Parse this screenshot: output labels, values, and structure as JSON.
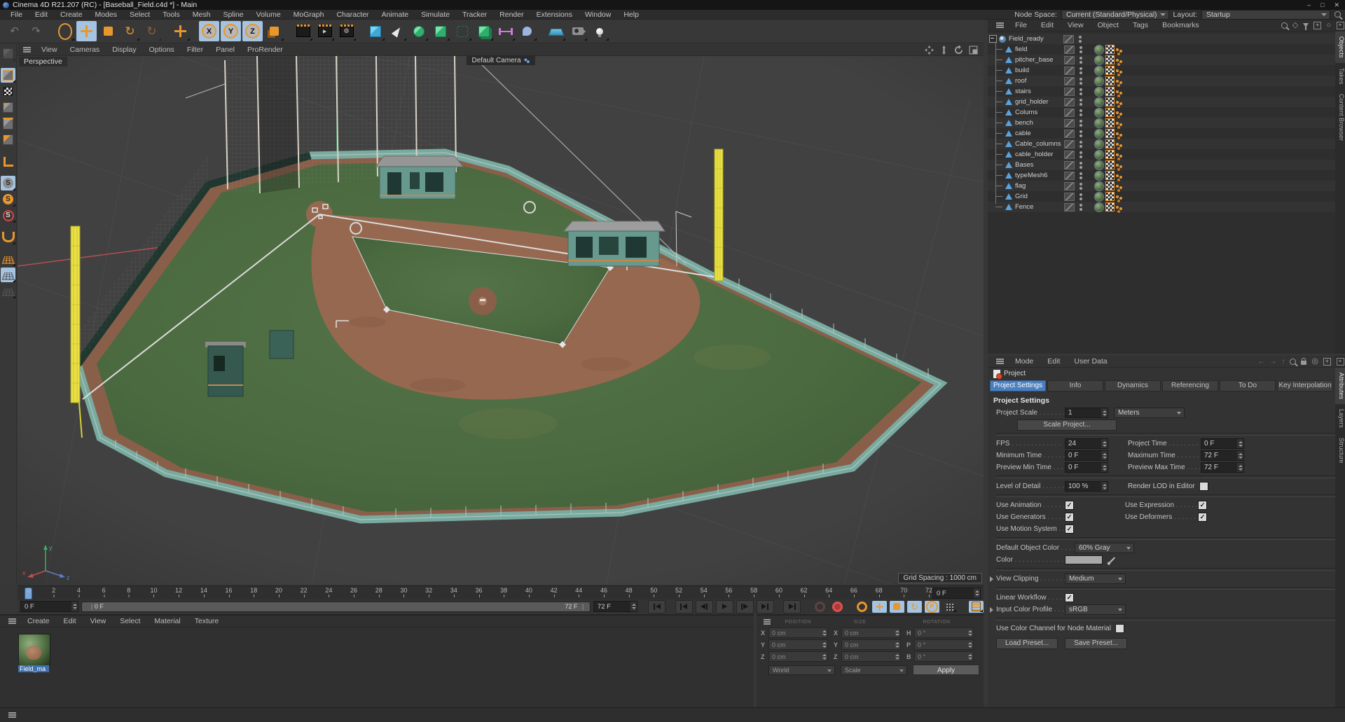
{
  "titlebar": {
    "title": "Cinema 4D R21.207 (RC) - [Baseball_Field.c4d *] - Main",
    "minimize": "–",
    "maximize": "□",
    "close": "✕"
  },
  "menubar": {
    "items": [
      "File",
      "Edit",
      "Create",
      "Modes",
      "Select",
      "Tools",
      "Mesh",
      "Spline",
      "Volume",
      "MoGraph",
      "Character",
      "Animate",
      "Simulate",
      "Tracker",
      "Render",
      "Extensions",
      "Window",
      "Help"
    ],
    "node_space_label": "Node Space:",
    "node_space_value": "Current (Standard/Physical)",
    "layout_label": "Layout:",
    "layout_value": "Startup"
  },
  "toolbar": {
    "axis_x": "X",
    "axis_y": "Y",
    "axis_z": "Z"
  },
  "palette": {
    "solo_letter": "S"
  },
  "viewport": {
    "menu": [
      "View",
      "Cameras",
      "Display",
      "Options",
      "Filter",
      "Panel",
      "ProRender"
    ],
    "view_label": "Perspective",
    "camera_label": "Default Camera",
    "grid_spacing": "Grid Spacing : 1000 cm",
    "axis_x": "x",
    "axis_y": "y",
    "axis_z": "z"
  },
  "timeline": {
    "ticks": [
      "0",
      "2",
      "4",
      "6",
      "8",
      "10",
      "12",
      "14",
      "16",
      "18",
      "20",
      "22",
      "24",
      "26",
      "28",
      "30",
      "32",
      "34",
      "36",
      "38",
      "40",
      "42",
      "44",
      "46",
      "48",
      "50",
      "52",
      "54",
      "56",
      "58",
      "60",
      "62",
      "64",
      "66",
      "68",
      "70",
      "72"
    ],
    "current_frame": "0 F",
    "start_frame": "0 F",
    "range_start_label": "0 F",
    "range_end_label": "72 F",
    "end_frame": "72 F",
    "marker_p": "P"
  },
  "materials": {
    "menu": [
      "Create",
      "Edit",
      "View",
      "Select",
      "Material",
      "Texture"
    ],
    "material_name": "Field_ma"
  },
  "coordinates": {
    "headers": [
      "POSITION",
      "SIZE",
      "ROTATION"
    ],
    "position": {
      "x_label": "X",
      "x": "0 cm",
      "y_label": "Y",
      "y": "0 cm",
      "z_label": "Z",
      "z": "0 cm",
      "mode": "World"
    },
    "size": {
      "x_label": "X",
      "x": "0 cm",
      "y_label": "Y",
      "y": "0 cm",
      "z_label": "Z",
      "z": "0 cm",
      "mode": "Scale"
    },
    "rotation": {
      "h_label": "H",
      "h": "0 °",
      "p_label": "P",
      "p": "0 °",
      "b_label": "B",
      "b": "0 °",
      "apply": "Apply"
    }
  },
  "object_manager": {
    "menu": [
      "File",
      "Edit",
      "View",
      "Object",
      "Tags",
      "Bookmarks"
    ],
    "root": {
      "name": "Field_ready"
    },
    "children": [
      {
        "name": "field"
      },
      {
        "name": "pitcher_base"
      },
      {
        "name": "build"
      },
      {
        "name": "roof"
      },
      {
        "name": "stairs"
      },
      {
        "name": "grid_holder"
      },
      {
        "name": "Colums"
      },
      {
        "name": "bench"
      },
      {
        "name": "cable"
      },
      {
        "name": "Cable_columns"
      },
      {
        "name": "cable_holder"
      },
      {
        "name": "Bases"
      },
      {
        "name": "typeMesh6"
      },
      {
        "name": "flag"
      },
      {
        "name": "Grid"
      },
      {
        "name": "Fence"
      }
    ]
  },
  "attributes": {
    "menu": [
      "Mode",
      "Edit",
      "User Data"
    ],
    "object_label": "Project",
    "tabs": [
      {
        "label": "Project Settings",
        "active": true
      },
      {
        "label": "Info"
      },
      {
        "label": "Dynamics"
      },
      {
        "label": "Referencing"
      },
      {
        "label": "To Do"
      },
      {
        "label": "Key Interpolation"
      }
    ],
    "section_title": "Project Settings",
    "project_scale_label": "Project Scale",
    "project_scale_value": "1",
    "project_scale_unit": "Meters",
    "scale_project_button": "Scale Project...",
    "fps_label": "FPS",
    "fps_value": "24",
    "project_time_label": "Project Time",
    "project_time_value": "0 F",
    "minimum_time_label": "Minimum Time",
    "minimum_time_value": "0 F",
    "maximum_time_label": "Maximum Time",
    "maximum_time_value": "72 F",
    "preview_min_label": "Preview Min Time",
    "preview_min_value": "0 F",
    "preview_max_label": "Preview Max Time",
    "preview_max_value": "72 F",
    "lod_label": "Level of Detail",
    "lod_value": "100 %",
    "render_lod_label": "Render LOD in Editor",
    "use_animation_label": "Use Animation",
    "use_expression_label": "Use Expression",
    "use_generators_label": "Use Generators",
    "use_deformers_label": "Use Deformers",
    "use_motion_label": "Use Motion System",
    "default_color_label": "Default Object Color",
    "default_color_value": "60% Gray",
    "color_label": "Color",
    "view_clipping_label": "View Clipping",
    "view_clipping_value": "Medium",
    "linear_workflow_label": "Linear Workflow",
    "input_profile_label": "Input Color Profile",
    "input_profile_value": "sRGB",
    "node_material_label": "Use Color Channel for Node Material",
    "load_preset": "Load Preset...",
    "save_preset": "Save Preset...",
    "checks": {
      "use_animation": true,
      "use_expression": true,
      "use_generators": true,
      "use_deformers": true,
      "use_motion_system": true,
      "render_lod": false,
      "linear_workflow": true,
      "node_material": false
    }
  },
  "side_tabs": {
    "top": [
      {
        "label": "Objects",
        "active": true
      },
      {
        "label": "Takes"
      },
      {
        "label": "Content Browser"
      }
    ],
    "bottom": [
      {
        "label": "Attributes",
        "active": true
      },
      {
        "label": "Layers"
      },
      {
        "label": "Structure"
      }
    ]
  },
  "colors": {
    "accent_tab_blue": "#4a7fc1",
    "toolbar_highlight": "#a5c4e2",
    "selection_blue": "#3f6fae",
    "c4d_orange": "#e8962e",
    "grass_green": "#4b6a40",
    "dirt_brown": "#96684f",
    "fence_teal": "#79aaa0",
    "foul_pole_yellow": "#e9e044"
  }
}
